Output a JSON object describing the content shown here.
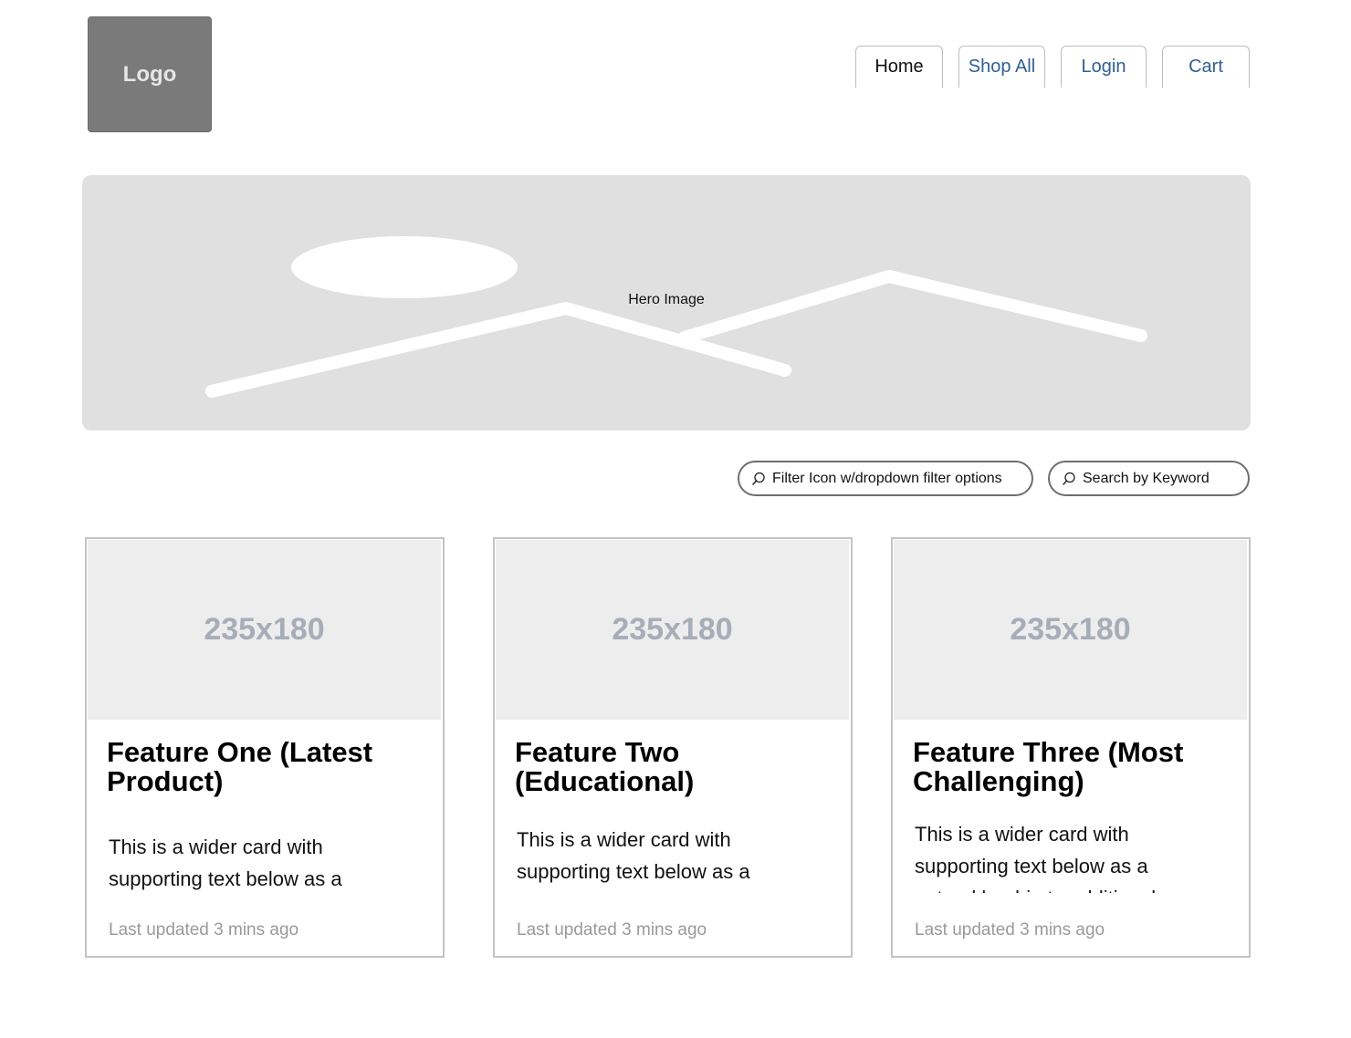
{
  "header": {
    "logo_label": "Logo",
    "nav": [
      {
        "label": "Home",
        "active": true
      },
      {
        "label": "Shop All",
        "active": false
      },
      {
        "label": "Login",
        "active": false
      },
      {
        "label": "Cart",
        "active": false
      }
    ]
  },
  "hero": {
    "label": "Hero Image",
    "icon": "image-placeholder-icon"
  },
  "search": {
    "filter_placeholder": "Filter Icon w/dropdown filter options",
    "keyword_placeholder": "Search by Keyword",
    "icon": "search-icon"
  },
  "cards": [
    {
      "image_label": "235x180",
      "title": "Feature One (Latest Product)",
      "text": "This is a wider card with supporting text below as a",
      "meta": "Last updated 3 mins ago"
    },
    {
      "image_label": "235x180",
      "title": "Feature Two (Educational)",
      "text": "This is a wider card with supporting text below as a",
      "meta": "Last updated 3 mins ago"
    },
    {
      "image_label": "235x180",
      "title": "Feature Three (Most Challenging)",
      "text": "This is a wider card with supporting text below as a natural lead-in to additional",
      "meta": "Last updated 3 mins ago"
    }
  ],
  "colors": {
    "link": "#2f5e9a",
    "logo_bg": "#7a7a7a",
    "hero_bg": "#e0e0e0",
    "card_image_bg": "#ededed",
    "muted_text": "#9a9a9a"
  }
}
